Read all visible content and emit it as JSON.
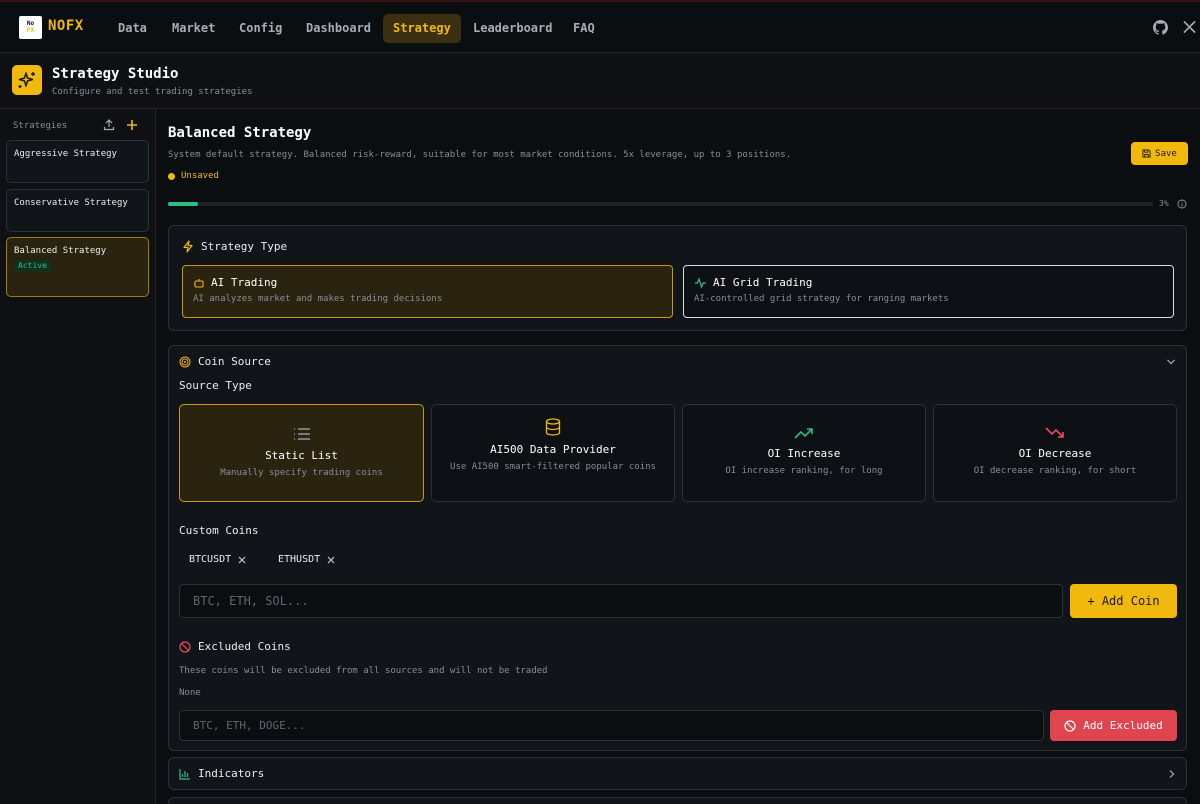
{
  "app": {
    "logo_text": "NOFX",
    "logo_mark_top": "No",
    "logo_mark_bottom": "FX"
  },
  "nav": {
    "items": [
      {
        "label": "Data",
        "name": "nav-data"
      },
      {
        "label": "Market",
        "name": "nav-market"
      },
      {
        "label": "Config",
        "name": "nav-config"
      },
      {
        "label": "Dashboard",
        "name": "nav-dashboard"
      },
      {
        "label": "Strategy",
        "name": "nav-strategy",
        "active": true
      },
      {
        "label": "Leaderboard",
        "name": "nav-leaderboard"
      },
      {
        "label": "FAQ",
        "name": "nav-faq"
      }
    ],
    "right_icons": [
      "github-icon",
      "x-twitter-icon"
    ]
  },
  "studio": {
    "title": "Strategy Studio",
    "subtitle": "Configure and test trading strategies",
    "icon": "sparkles-icon"
  },
  "sidebar": {
    "label": "Strategies",
    "items": [
      {
        "name": "Aggressive Strategy",
        "active": false
      },
      {
        "name": "Conservative Strategy",
        "active": false
      },
      {
        "name": "Balanced Strategy",
        "active": true,
        "badge": "Active"
      }
    ]
  },
  "strategy": {
    "title": "Balanced Strategy",
    "description": "System default strategy. Balanced risk-reward, suitable for most market conditions. 5x leverage, up to 3 positions.",
    "status": "Unsaved",
    "save_label": "Save",
    "progress_percent": 3,
    "progress_label": "3%"
  },
  "strategy_type": {
    "title": "Strategy Type",
    "options": [
      {
        "title": "AI Trading",
        "desc": "AI analyzes market and makes trading decisions",
        "icon": "robot-icon",
        "selected": true
      },
      {
        "title": "AI Grid Trading",
        "desc": "AI-controlled grid strategy for ranging markets",
        "icon": "activity-icon",
        "selected": false
      }
    ]
  },
  "coin_source": {
    "title": "Coin Source",
    "source_type_label": "Source Type",
    "sources": [
      {
        "title": "Static List",
        "desc": "Manually specify trading coins",
        "icon": "list-icon",
        "selected": true
      },
      {
        "title": "AI500 Data Provider",
        "desc": "Use AI500 smart-filtered popular coins",
        "icon": "database-icon",
        "selected": false
      },
      {
        "title": "OI Increase",
        "desc": "OI increase ranking, for long",
        "icon": "trending-up-icon",
        "selected": false
      },
      {
        "title": "OI Decrease",
        "desc": "OI decrease ranking, for short",
        "icon": "trending-down-icon",
        "selected": false
      }
    ],
    "custom_coins_label": "Custom Coins",
    "coins": [
      "BTCUSDT",
      "ETHUSDT"
    ],
    "coin_input_placeholder": "BTC, ETH, SOL...",
    "add_coin_label": "+ Add Coin",
    "excluded": {
      "title": "Excluded Coins",
      "desc": "These coins will be excluded from all sources and will not be traded",
      "none_label": "None",
      "input_placeholder": "BTC, ETH, DOGE...",
      "add_label": "Add Excluded"
    }
  },
  "indicators": {
    "title": "Indicators"
  },
  "colors": {
    "accent": "#f0b90b",
    "green": "#2ebd85",
    "red": "#f6465d",
    "bg": "#0b0e11"
  }
}
